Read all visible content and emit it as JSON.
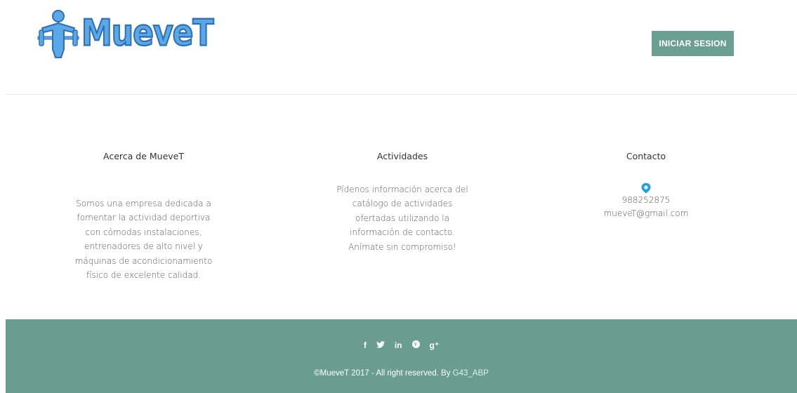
{
  "header": {
    "logo_text": "MueveT",
    "login_label": "INICIAR SESION"
  },
  "about": {
    "title": "Acerca de MueveT",
    "text": "Somos una empresa dedicada a fomentar la actividad deportiva con cómodas instalaciones, entrenadores de alto nivel y máquinas de acondicionamiento físico de excelente calidad."
  },
  "activities": {
    "title": "Actividades",
    "text": "Pídenos información acerca del catálogo de actividades ofertadas utilizando la información de contacto. Anímate sin compromiso!"
  },
  "contact": {
    "title": "Contacto",
    "icon": "location-pin-icon",
    "phone": "988252875",
    "email": "mueveT@gmail.com"
  },
  "footer": {
    "social": [
      {
        "name": "facebook-icon",
        "glyph": "f"
      },
      {
        "name": "twitter-icon",
        "glyph": "🐦"
      },
      {
        "name": "linkedin-icon",
        "glyph": "in"
      },
      {
        "name": "pinterest-icon",
        "glyph": "℗"
      },
      {
        "name": "google-plus-icon",
        "glyph": "g+"
      }
    ],
    "copyright": "©MueveT 2017 - All right reserved. By ",
    "author_link": "G43_ABP"
  },
  "colors": {
    "accent": "#6a9c8f",
    "logo_blue": "#5aa8e8",
    "pin_blue": "#1fa3e0"
  }
}
